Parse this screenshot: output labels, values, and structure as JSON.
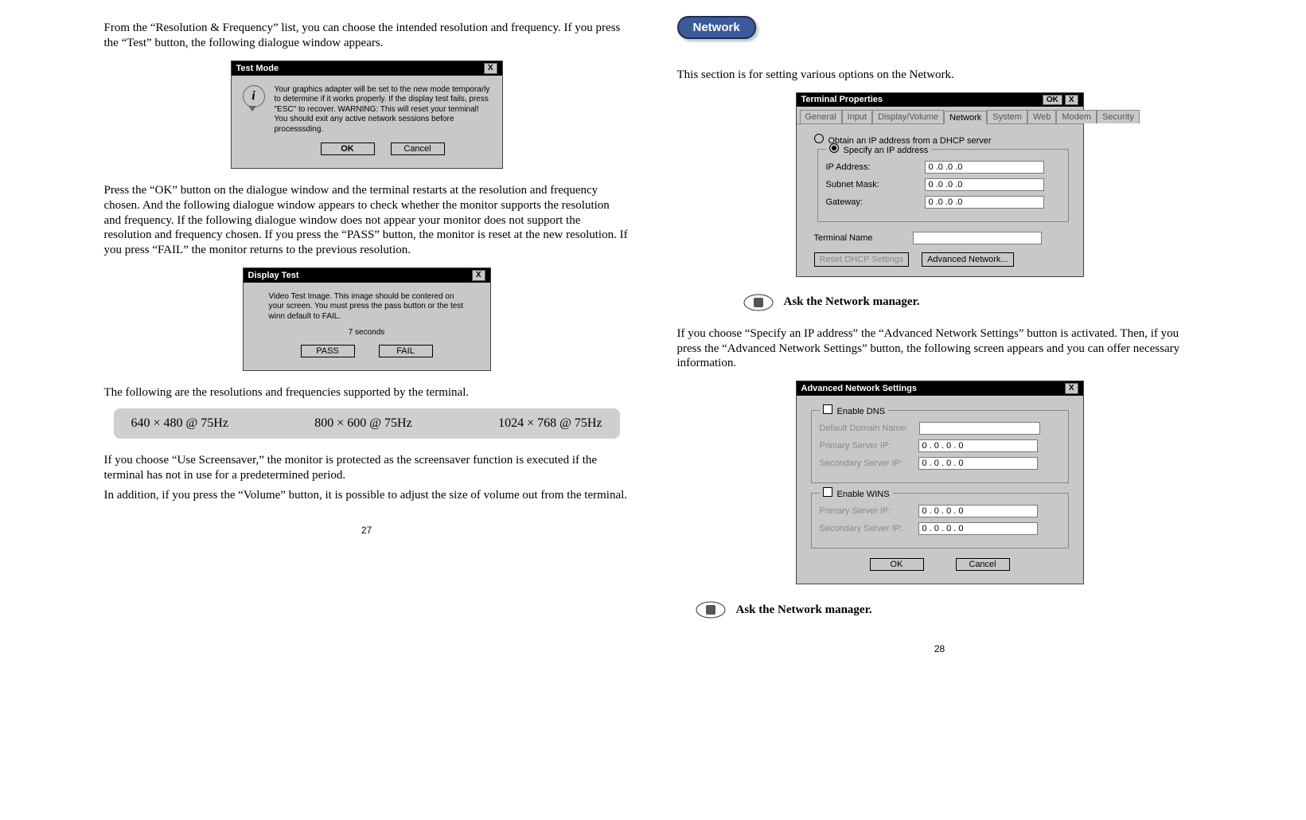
{
  "left": {
    "p1": "From the “Resolution & Frequency” list, you can choose the intended resolution and frequency.  If you press the “Test” button, the following dialogue window appears.",
    "dlg1": {
      "title": "Test Mode",
      "close": "X",
      "body": "Your graphics adapter will be set to the new mode temporarly to determine if it works properly. If the display test fails, press \"ESC\" to recover.  WARNING: This will reset your terminal!  You should exit any active network sessions before processsding.",
      "ok": "OK",
      "cancel": "Cancel"
    },
    "p2": "Press the “OK” button on the dialogue window and the terminal restarts at the resolution and frequency chosen. And the following dialogue window appears to check whether the monitor supports the resolution and frequency. If the following dialogue window does not appear your monitor does not support the resolution and frequency chosen. If you press the “PASS” button, the monitor is reset at the new resolution. If you press “FAIL” the monitor returns to the previous resolution.",
    "dlg2": {
      "title": "Display Test",
      "close": "X",
      "body": "Video Test Image.  This image should be contered on your screen.  You must press the pass button or the test winn default to FAIL.",
      "seconds": "7 seconds",
      "pass": "PASS",
      "fail": "FAIL"
    },
    "p3": "The following are the resolutions and frequencies supported by the terminal.",
    "res1": "640 × 480  @ 75Hz",
    "res2": "800 × 600  @ 75Hz",
    "res3": "1024 × 768  @ 75Hz",
    "p4": "If you choose “Use Screensaver,” the monitor is protected as the screensaver function is executed if the terminal has not in use for a predetermined period.",
    "p5": "In addition, if you press the “Volume” button, it is possible to adjust the size of volume out from the terminal.",
    "page": "27"
  },
  "right": {
    "badge": "Network",
    "p1": "This section is for setting various options on the Network.",
    "dlg3": {
      "title": "Terminal Properties",
      "okbtn": "OK",
      "close": "X",
      "tabs": [
        "General",
        "Input",
        "Display/Volume",
        "Network",
        "System",
        "Web",
        "Modem",
        "Security"
      ],
      "r1": "Obtain an IP address from a DHCP server",
      "r2": "Specify an IP address",
      "ipaddr": "IP Address:",
      "subnet": "Subnet Mask:",
      "gateway": "Gateway:",
      "ipval": "0     .0     .0     .0",
      "termname": "Terminal Name",
      "reset": "Reset DHCP Settings",
      "advnet": "Advanced Network..."
    },
    "tip": "Ask the Network manager.",
    "p2": "If you choose “Specify an IP address” the “Advanced Network Settings” button is activated. Then, if you press the “Advanced Network Settings” button, the following screen appears and you can offer necessary information.",
    "dlg4": {
      "title": "Advanced Network Settings",
      "close": "X",
      "dns": "Enable DNS",
      "ddn": "Default Domain Name:",
      "psi": "Primary Server IP:",
      "ssi": "Secondary Server IP:",
      "wins": "Enable WINS",
      "ipval": "0       . 0       . 0       . 0",
      "ok": "OK",
      "cancel": "Cancel"
    },
    "page": "28"
  }
}
